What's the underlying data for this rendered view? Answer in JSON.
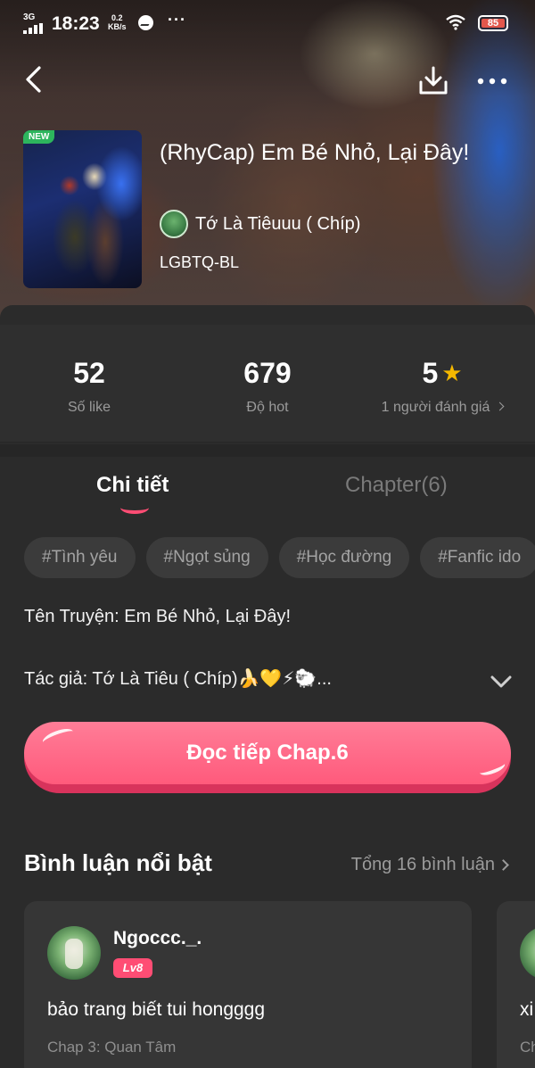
{
  "status_bar": {
    "network": "3G",
    "time": "18:23",
    "speed_value": "0.2",
    "speed_unit": "KB/s",
    "dots": "···",
    "battery": "85"
  },
  "book": {
    "badge": "NEW",
    "title": "(RhyCap) Em Bé Nhỏ, Lại Đây!",
    "author": "Tớ Là Tiêuuu ( Chíp)",
    "genre": "LGBTQ-BL"
  },
  "stats": [
    {
      "value": "52",
      "label": "Số like"
    },
    {
      "value": "679",
      "label": "Độ hot"
    },
    {
      "value": "5",
      "label": "1 người đánh giá"
    }
  ],
  "tabs": {
    "details": "Chi tiết",
    "chapters": "Chapter(6)"
  },
  "tags": [
    "#Tình yêu",
    "#Ngọt sủng",
    "#Học đường",
    "#Fanfic ido"
  ],
  "description": {
    "line1": "Tên Truyện: Em Bé Nhỏ, Lại Đây!",
    "line2": "Tác giả: Tớ Là Tiêu ( Chíp)🍌💛⚡🐑..."
  },
  "read_button": "Đọc tiếp Chap.6",
  "comments_section": {
    "heading": "Bình luận nổi bật",
    "total": "Tổng 16 bình luận",
    "items": [
      {
        "user": "Ngoccc._.",
        "level": "Lv8",
        "text": "bảo trang biết tui hongggg",
        "chapter": "Chap 3: Quan Tâm"
      },
      {
        "text": "xi",
        "chapter": "Ch"
      }
    ]
  }
}
